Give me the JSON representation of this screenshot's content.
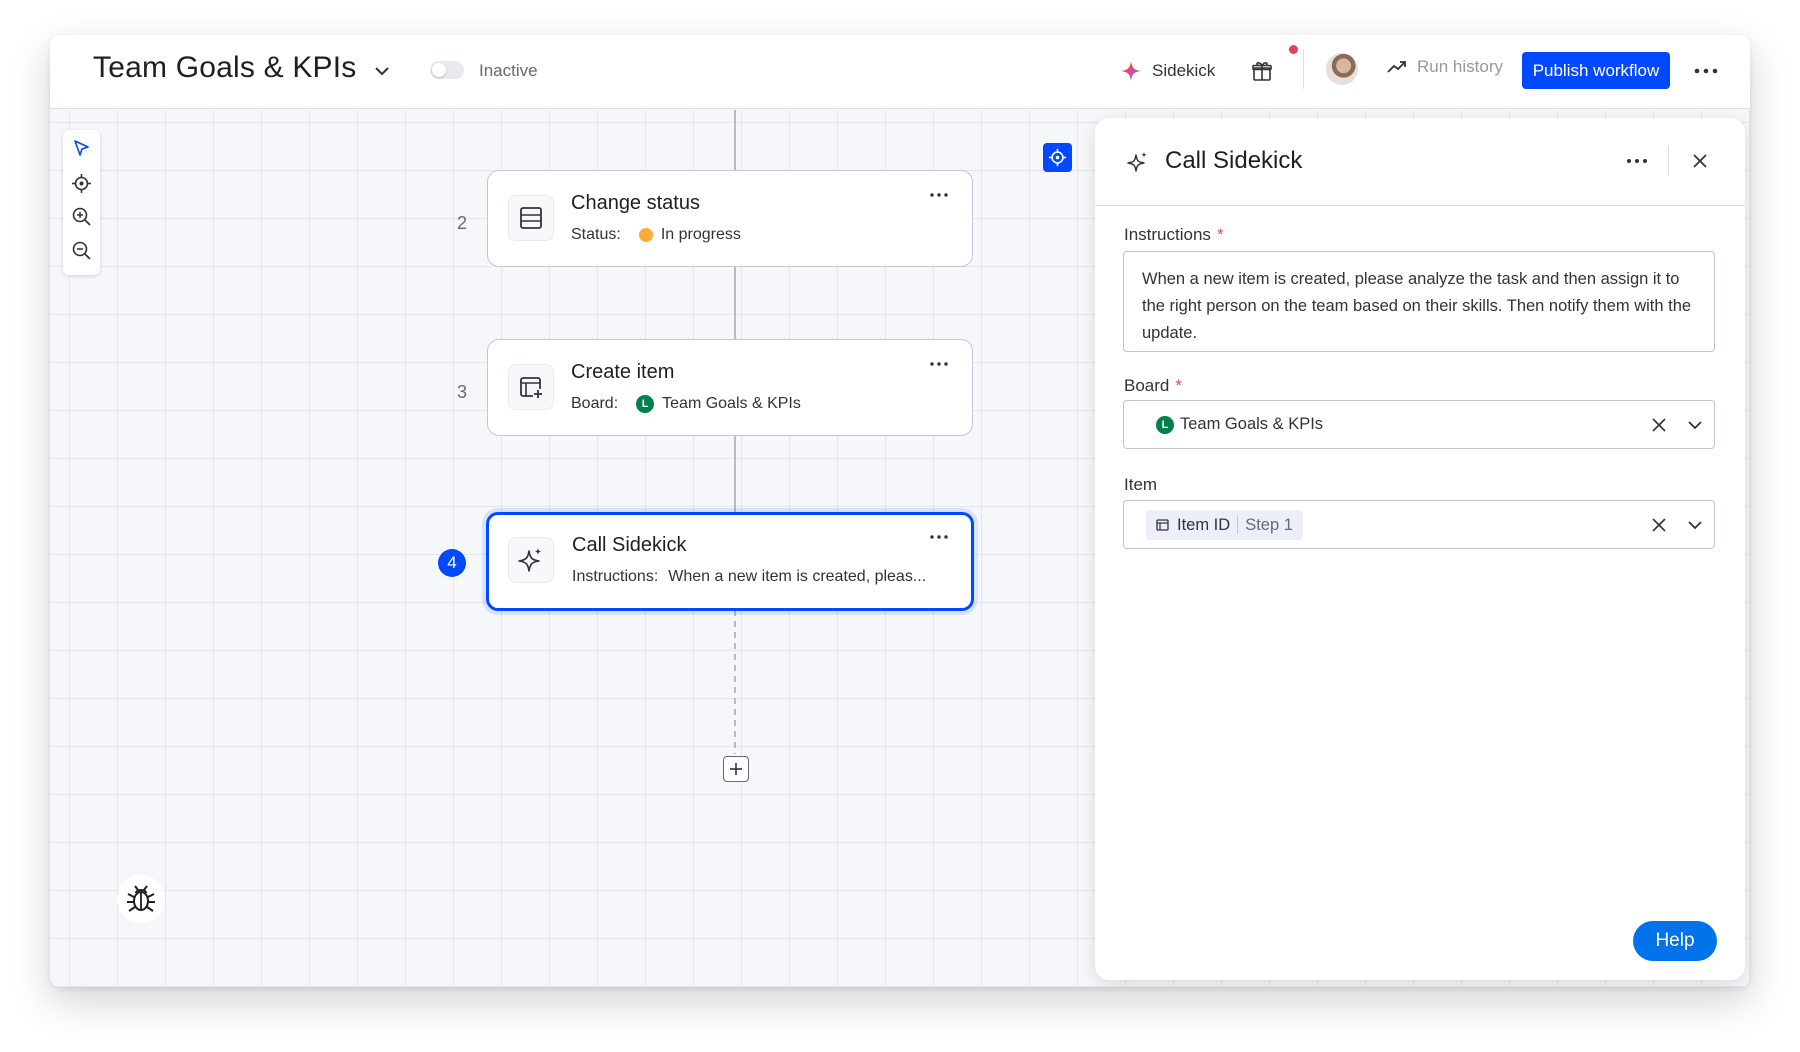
{
  "header": {
    "title": "Team Goals & KPIs",
    "status_label": "Inactive",
    "sidekick_label": "Sidekick",
    "run_history_label": "Run history",
    "publish_label": "Publish workflow"
  },
  "canvas": {
    "steps": [
      {
        "number": "2",
        "title": "Change status",
        "sub_key": "Status:",
        "sub_value": "In progress"
      },
      {
        "number": "3",
        "title": "Create item",
        "sub_key": "Board:",
        "badge": "L",
        "sub_value": "Team Goals & KPIs"
      },
      {
        "number": "4",
        "title": "Call Sidekick",
        "sub_key": "Instructions:",
        "sub_value": "When a new item is created, pleas..."
      }
    ]
  },
  "panel": {
    "title": "Call Sidekick",
    "instructions_label": "Instructions",
    "required_mark": "*",
    "instructions_value": "When a new item is created, please analyze the task and then assign it to the right person on the team based on their skills. Then notify them with the update.",
    "board_label": "Board",
    "board_badge": "L",
    "board_value": "Team Goals & KPIs",
    "item_label": "Item",
    "item_chip_label": "Item ID",
    "item_chip_step": "Step 1",
    "help_label": "Help"
  },
  "colors": {
    "accent": "#0049ff",
    "status_in_progress": "#fdab3d",
    "board_badge": "#037f4c",
    "notification": "#e2445c",
    "help": "#0073ea"
  }
}
